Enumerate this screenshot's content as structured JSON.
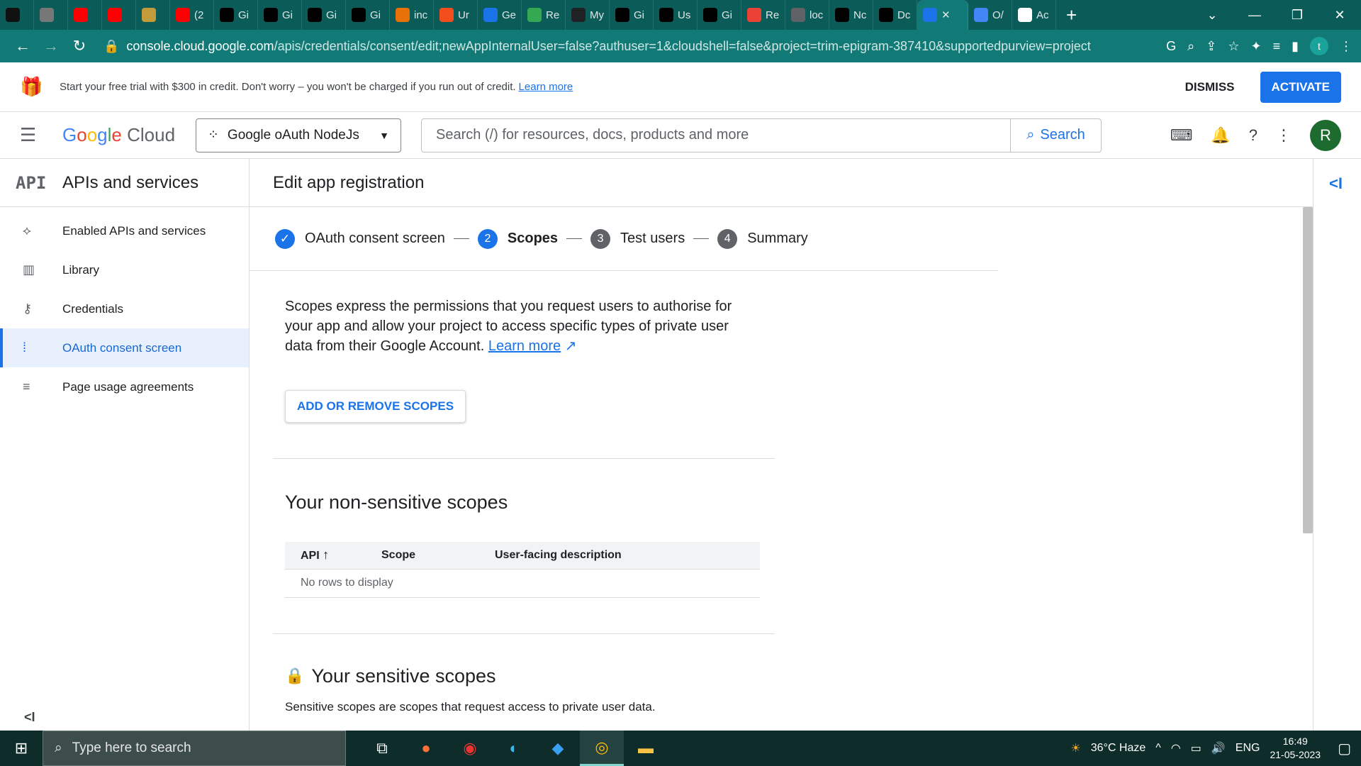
{
  "browser": {
    "tabs": [
      {
        "icon_name": "k-icon",
        "label": "",
        "color": "#111111"
      },
      {
        "icon_name": "mg-icon",
        "label": "",
        "color": "#777777"
      },
      {
        "icon_name": "youtube-icon",
        "label": "",
        "color": "#ff0000"
      },
      {
        "icon_name": "youtube-icon",
        "label": "",
        "color": "#ff0000"
      },
      {
        "icon_name": "reward-icon",
        "label": "",
        "color": "#c49b3a"
      },
      {
        "icon_name": "youtube-icon",
        "label": "(2",
        "color": "#ff0000"
      },
      {
        "icon_name": "github-icon",
        "label": "Gi",
        "color": "#000000"
      },
      {
        "icon_name": "github-icon",
        "label": "Gi",
        "color": "#000000"
      },
      {
        "icon_name": "github-icon",
        "label": "Gi",
        "color": "#000000"
      },
      {
        "icon_name": "github-icon",
        "label": "Gi",
        "color": "#000000"
      },
      {
        "icon_name": "app-icon",
        "label": "inc",
        "color": "#e8710a"
      },
      {
        "icon_name": "figma-icon",
        "label": "Ur",
        "color": "#f24e1e"
      },
      {
        "icon_name": "flag-icon",
        "label": "Ge",
        "color": "#1a73e8"
      },
      {
        "icon_name": "four-icon",
        "label": "Re",
        "color": "#34a853"
      },
      {
        "icon_name": "info-icon",
        "label": "My",
        "color": "#202124"
      },
      {
        "icon_name": "github-icon",
        "label": "Gi",
        "color": "#000000"
      },
      {
        "icon_name": "p-icon",
        "label": "Us",
        "color": "#000000"
      },
      {
        "icon_name": "github-icon",
        "label": "Gi",
        "color": "#000000"
      },
      {
        "icon_name": "gmail-icon",
        "label": "Re",
        "color": "#ea4335"
      },
      {
        "icon_name": "globe-icon",
        "label": "loc",
        "color": "#5f6368"
      },
      {
        "icon_name": "medium-icon",
        "label": "Nc",
        "color": "#000000"
      },
      {
        "icon_name": "p-icon",
        "label": "Dc",
        "color": "#000000"
      },
      {
        "icon_name": "api-icon",
        "label": "",
        "color": "#1a73e8",
        "active": true
      },
      {
        "icon_name": "google-icon",
        "label": "O/",
        "color": "#4285f4"
      },
      {
        "icon_name": "wikipedia-icon",
        "label": "Ac",
        "color": "#ffffff"
      }
    ],
    "new_tab": "+",
    "url_domain": "console.cloud.google.com",
    "url_rest": "/apis/credentials/consent/edit;newAppInternalUser=false?authuser=1&cloudshell=false&project=trim-epigram-387410&supportedpurview=project",
    "profile_initial": "t"
  },
  "banner": {
    "message": "Start your free trial with $300 in credit. Don't worry – you won't be charged if you run out of credit.",
    "learn_more": "Learn more",
    "dismiss": "DISMISS",
    "activate": "ACTIVATE"
  },
  "header": {
    "logo": {
      "google": "Google",
      "cloud": "Cloud"
    },
    "project": "Google oAuth NodeJs",
    "search_placeholder": "Search (/) for resources, docs, products and more",
    "search_button": "Search",
    "user_initial": "R"
  },
  "sidenav": {
    "api_badge": "API",
    "title": "APIs and services",
    "items": [
      {
        "label": "Enabled APIs and services",
        "icon": "enabled-apis-icon"
      },
      {
        "label": "Library",
        "icon": "library-icon"
      },
      {
        "label": "Credentials",
        "icon": "key-icon"
      },
      {
        "label": "OAuth consent screen",
        "icon": "consent-icon",
        "active": true
      },
      {
        "label": "Page usage agreements",
        "icon": "agreements-icon"
      }
    ],
    "collapse": "<I"
  },
  "main": {
    "title": "Edit app registration",
    "steps": [
      {
        "num": "✓",
        "label": "OAuth consent screen",
        "state": "done"
      },
      {
        "num": "2",
        "label": "Scopes",
        "state": "current"
      },
      {
        "num": "3",
        "label": "Test users",
        "state": "todo"
      },
      {
        "num": "4",
        "label": "Summary",
        "state": "todo"
      }
    ],
    "intro": "Scopes express the permissions that you request users to authorise for your app and allow your project to access specific types of private user data from their Google Account.",
    "intro_link": "Learn more",
    "add_scopes_button": "ADD OR REMOVE SCOPES",
    "non_sensitive": {
      "title": "Your non-sensitive scopes",
      "columns": [
        "API",
        "Scope",
        "User-facing description"
      ],
      "empty": "No rows to display"
    },
    "sensitive": {
      "title": "Your sensitive scopes",
      "description": "Sensitive scopes are scopes that request access to private user data."
    }
  },
  "taskbar": {
    "search_placeholder": "Type here to search",
    "weather": "36°C  Haze",
    "lang": "ENG",
    "time": "16:49",
    "date": "21-05-2023"
  }
}
